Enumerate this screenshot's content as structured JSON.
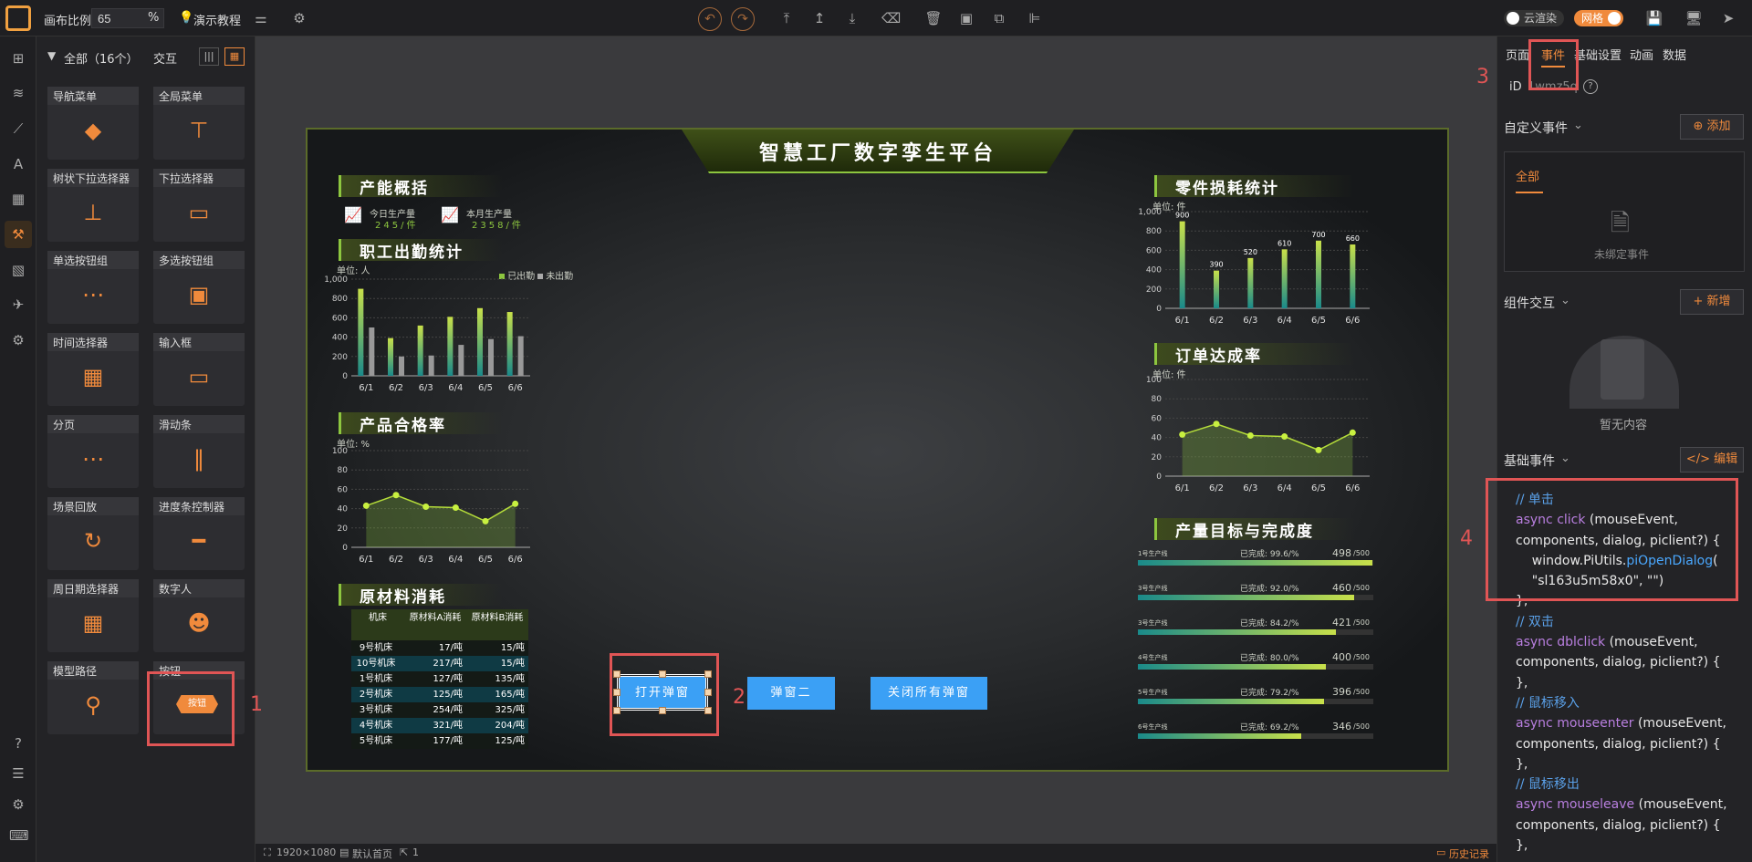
{
  "topbar": {
    "scale_label": "画布比例",
    "scale_value": "65",
    "scale_unit": "%",
    "tutorial": "演示教程",
    "cloud_render": "云渲染",
    "grid": "网格"
  },
  "panel": {
    "filter": "全部（16个）",
    "interaction": "交互",
    "components": [
      "导航菜单",
      "全局菜单",
      "树状下拉选择器",
      "下拉选择器",
      "单选按钮组",
      "多选按钮组",
      "时间选择器",
      "输入框",
      "分页",
      "滑动条",
      "场景回放",
      "进度条控制器",
      "周日期选择器",
      "数字人",
      "模型路径",
      "按钮"
    ],
    "button_preview": "按钮"
  },
  "screen": {
    "title": "智慧工厂数字孪生平台",
    "capacity": {
      "title": "产能概括",
      "today_label": "今日生产量",
      "today_value": "245/件",
      "month_label": "本月生产量",
      "month_value": "2358/件"
    },
    "attendance": {
      "title": "职工出勤统计",
      "unit": "单位: 人",
      "legend": [
        "已出勤",
        "未出勤"
      ]
    },
    "quality": {
      "title": "产品合格率",
      "unit": "单位: %"
    },
    "materials": {
      "title": "原材料消耗",
      "headers": [
        "机床",
        "原材料A消耗",
        "原材料B消耗"
      ],
      "rows": [
        [
          "9号机床",
          "17/吨",
          "15/吨"
        ],
        [
          "10号机床",
          "217/吨",
          "15/吨"
        ],
        [
          "1号机床",
          "127/吨",
          "135/吨"
        ],
        [
          "2号机床",
          "125/吨",
          "165/吨"
        ],
        [
          "3号机床",
          "254/吨",
          "325/吨"
        ],
        [
          "4号机床",
          "321/吨",
          "204/吨"
        ],
        [
          "5号机床",
          "177/吨",
          "125/吨"
        ]
      ]
    },
    "parts": {
      "title": "零件损耗统计",
      "unit": "单位: 件"
    },
    "orders": {
      "title": "订单达成率",
      "unit": "单位: 件"
    },
    "targets": {
      "title": "产量目标与完成度",
      "rows": [
        {
          "name": "1号生产线",
          "done": "已完成: 99.6/%",
          "val": "498",
          "tot": "/500",
          "pct": 99.6
        },
        {
          "name": "3号生产线",
          "done": "已完成: 92.0/%",
          "val": "460",
          "tot": "/500",
          "pct": 92.0
        },
        {
          "name": "3号生产线",
          "done": "已完成: 84.2/%",
          "val": "421",
          "tot": "/500",
          "pct": 84.2
        },
        {
          "name": "4号生产线",
          "done": "已完成: 80.0/%",
          "val": "400",
          "tot": "/500",
          "pct": 80.0
        },
        {
          "name": "5号生产线",
          "done": "已完成: 79.2/%",
          "val": "396",
          "tot": "/500",
          "pct": 79.2
        },
        {
          "name": "6号生产线",
          "done": "已完成: 69.2/%",
          "val": "346",
          "tot": "/500",
          "pct": 69.2
        }
      ]
    },
    "buttons": [
      "打开弹窗",
      "弹窗二",
      "关闭所有弹窗"
    ]
  },
  "annotations": [
    "1",
    "2",
    "3",
    "4"
  ],
  "statusbar": {
    "size": "1920×1080",
    "home": "默认首页",
    "count": "1",
    "history": "历史记录"
  },
  "rpanel": {
    "tabs": [
      "页面",
      "事件",
      "基础设置",
      "动画",
      "数据"
    ],
    "id_label": "iD",
    "id_value": "1wmz5q",
    "custom_event": "自定义事件",
    "add": "添加",
    "all": "全部",
    "unbound": "未绑定事件",
    "interaction": "组件交互",
    "new": "新增",
    "empty": "暂无内容",
    "base_event": "基础事件",
    "edit": "编辑",
    "code": [
      {
        "t": "cm",
        "s": "// 单击"
      },
      {
        "t": "mix",
        "a": "async ",
        "b": "click",
        "c": " (mouseEvent,"
      },
      {
        "t": "str",
        "s": "components, dialog, piclient?) {"
      },
      {
        "t": "call",
        "s": "    window.PiUtils.",
        "f": "piOpenDialog",
        "e": "("
      },
      {
        "t": "str",
        "s": "    \"sl163u5m58x0\", \"\")"
      },
      {
        "t": "str",
        "s": "},"
      },
      {
        "t": "cm",
        "s": "// 双击"
      },
      {
        "t": "mix",
        "a": "async ",
        "b": "dblclick",
        "c": " (mouseEvent,"
      },
      {
        "t": "str",
        "s": "components, dialog, piclient?) {"
      },
      {
        "t": "str",
        "s": "},"
      },
      {
        "t": "cm",
        "s": "// 鼠标移入"
      },
      {
        "t": "mix",
        "a": "async ",
        "b": "mouseenter",
        "c": " (mouseEvent,"
      },
      {
        "t": "str",
        "s": "components, dialog, piclient?) {"
      },
      {
        "t": "str",
        "s": "},"
      },
      {
        "t": "cm",
        "s": "// 鼠标移出"
      },
      {
        "t": "mix",
        "a": "async ",
        "b": "mouseleave",
        "c": " (mouseEvent,"
      },
      {
        "t": "str",
        "s": "components, dialog, piclient?) {"
      },
      {
        "t": "str",
        "s": "},"
      }
    ]
  },
  "chart_data": [
    {
      "type": "bar",
      "title": "职工出勤统计",
      "ylabel": "单位: 人",
      "categories": [
        "6/1",
        "6/2",
        "6/3",
        "6/4",
        "6/5",
        "6/6"
      ],
      "ylim": [
        0,
        1000
      ],
      "yticks": [
        "0",
        "200",
        "400",
        "600",
        "800",
        "1,000"
      ],
      "series": [
        {
          "name": "已出勤",
          "values": [
            900,
            390,
            520,
            610,
            700,
            660
          ]
        },
        {
          "name": "未出勤",
          "values": [
            500,
            200,
            210,
            320,
            380,
            410
          ]
        }
      ]
    },
    {
      "type": "area",
      "title": "产品合格率",
      "ylabel": "单位: %",
      "categories": [
        "6/1",
        "6/2",
        "6/3",
        "6/4",
        "6/5",
        "6/6"
      ],
      "ylim": [
        0,
        100
      ],
      "yticks": [
        "0",
        "20",
        "40",
        "60",
        "80",
        "100"
      ],
      "series": [
        {
          "values": [
            43,
            54,
            42,
            41,
            27,
            45
          ]
        }
      ]
    },
    {
      "type": "bar",
      "title": "零件损耗统计",
      "ylabel": "单位: 件",
      "categories": [
        "6/1",
        "6/2",
        "6/3",
        "6/4",
        "6/5",
        "6/6"
      ],
      "ylim": [
        0,
        1000
      ],
      "yticks": [
        "0",
        "200",
        "400",
        "600",
        "800",
        "1,000"
      ],
      "series": [
        {
          "values": [
            900,
            390,
            520,
            610,
            700,
            660
          ]
        }
      ],
      "data_labels": [
        "900",
        "390",
        "520",
        "610",
        "700",
        "660"
      ]
    },
    {
      "type": "area",
      "title": "订单达成率",
      "ylabel": "单位: 件",
      "categories": [
        "6/1",
        "6/2",
        "6/3",
        "6/4",
        "6/5",
        "6/6"
      ],
      "ylim": [
        0,
        100
      ],
      "yticks": [
        "0",
        "20",
        "40",
        "60",
        "80",
        "100"
      ],
      "series": [
        {
          "values": [
            43,
            54,
            42,
            41,
            27,
            45
          ]
        }
      ]
    }
  ],
  "colors": {
    "accent": "#f08a3c",
    "red": "#e05555",
    "green": "#8dc63f",
    "blue": "#3ba0f5"
  }
}
